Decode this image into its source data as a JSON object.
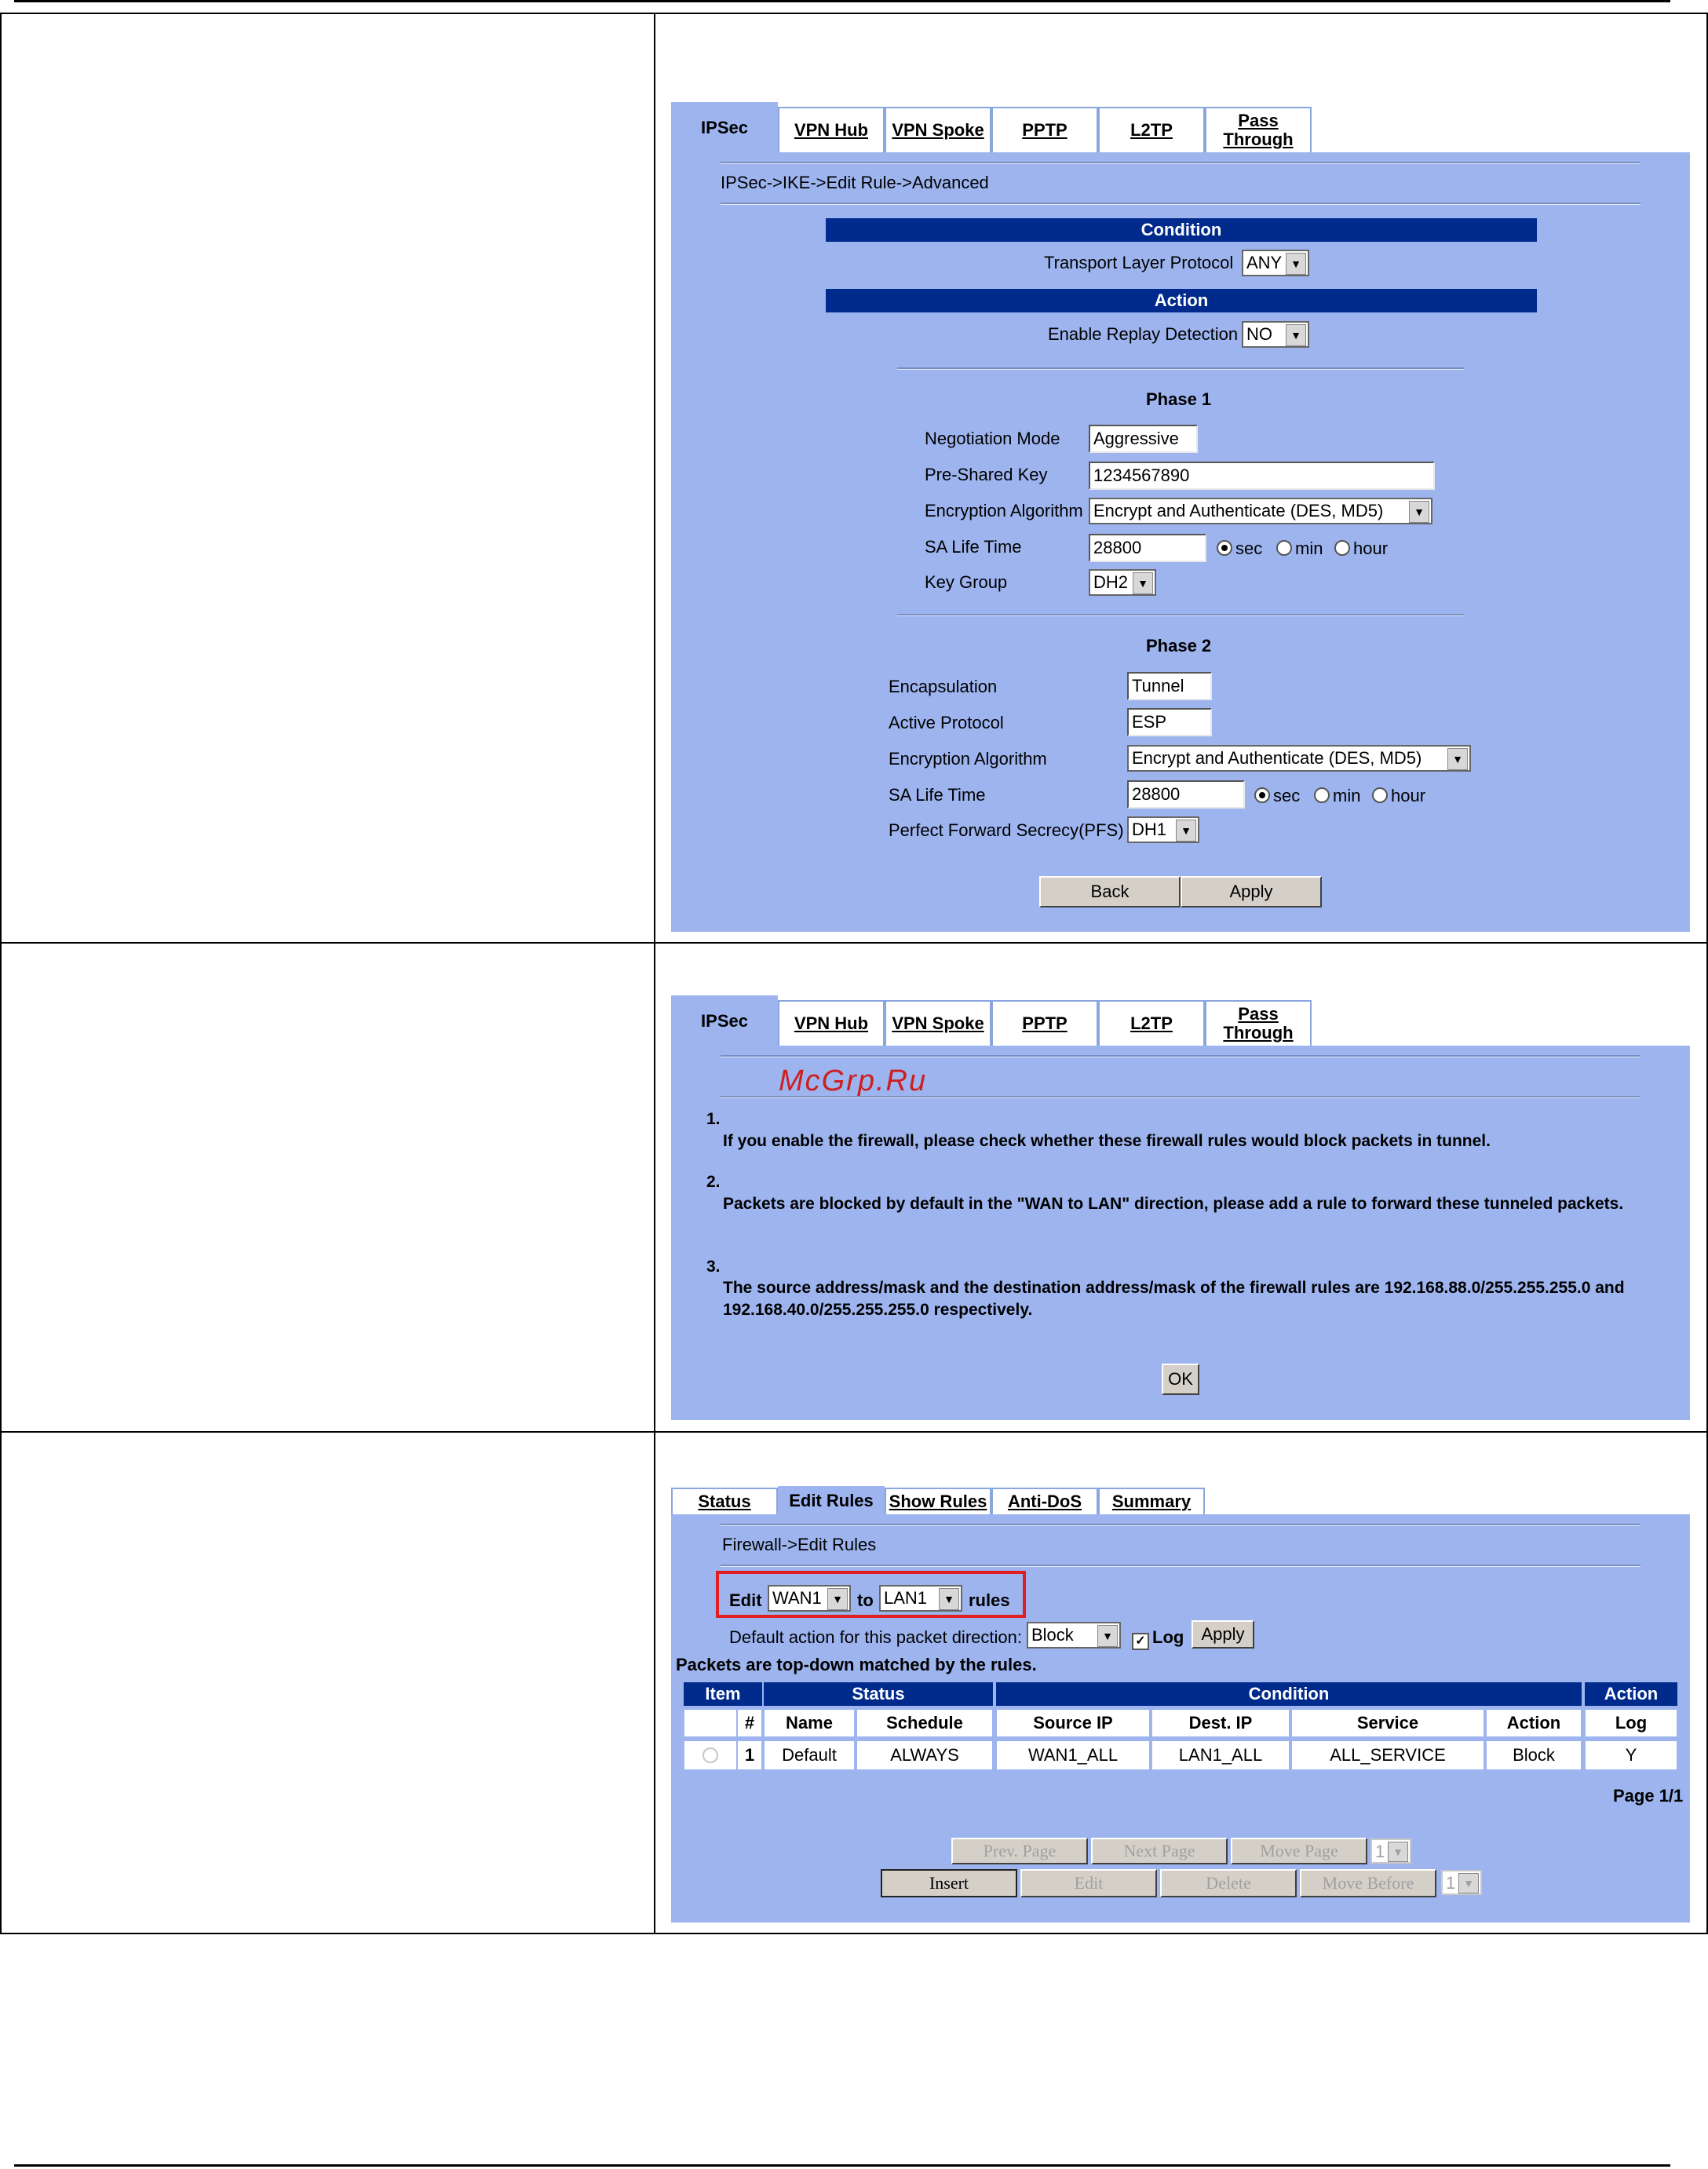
{
  "screen1": {
    "tabs": [
      {
        "label": "IPSec"
      },
      {
        "label": "VPN Hub"
      },
      {
        "label": "VPN Spoke"
      },
      {
        "label": "PPTP"
      },
      {
        "label": "L2TP"
      },
      {
        "label": "Pass Through"
      }
    ],
    "breadcrumb": "IPSec->IKE->Edit Rule->Advanced",
    "condition_header": "Condition",
    "transport_label": "Transport Layer Protocol",
    "transport_value": "ANY",
    "action_header": "Action",
    "replay_label": "Enable Replay Detection",
    "replay_value": "NO",
    "phase1": {
      "title": "Phase 1",
      "negotiation_label": "Negotiation Mode",
      "negotiation_value": "Aggressive",
      "psk_label": "Pre-Shared Key",
      "psk_value": "1234567890",
      "enc_label": "Encryption Algorithm",
      "enc_value": "Encrypt and Authenticate (DES, MD5)",
      "sa_label": "SA Life Time",
      "sa_value": "28800",
      "unit_sec": "sec",
      "unit_min": "min",
      "unit_hour": "hour",
      "keygroup_label": "Key Group",
      "keygroup_value": "DH2"
    },
    "phase2": {
      "title": "Phase 2",
      "encap_label": "Encapsulation",
      "encap_value": "Tunnel",
      "proto_label": "Active Protocol",
      "proto_value": "ESP",
      "enc_label": "Encryption Algorithm",
      "enc_value": "Encrypt and Authenticate (DES, MD5)",
      "sa_label": "SA Life Time",
      "sa_value": "28800",
      "unit_sec": "sec",
      "unit_min": "min",
      "unit_hour": "hour",
      "pfs_label": "Perfect Forward Secrecy(PFS)",
      "pfs_value": "DH1"
    },
    "back_label": "Back",
    "apply_label": "Apply"
  },
  "screen2": {
    "tabs": [
      {
        "label": "IPSec"
      },
      {
        "label": "VPN Hub"
      },
      {
        "label": "VPN Spoke"
      },
      {
        "label": "PPTP"
      },
      {
        "label": "L2TP"
      },
      {
        "label": "Pass Through"
      }
    ],
    "watermark": "McGrp.Ru",
    "notes": [
      {
        "num": "1.",
        "text": "If you enable the firewall, please check whether these firewall rules would block packets in tunnel."
      },
      {
        "num": "2.",
        "text": "Packets are blocked by default in the \"WAN to LAN\" direction, please add a rule to forward these tunneled packets."
      },
      {
        "num": "3.",
        "text": "The source address/mask and the destination address/mask of the firewall rules are 192.168.88.0/255.255.255.0 and 192.168.40.0/255.255.255.0 respectively."
      }
    ],
    "ok_label": "OK"
  },
  "screen3": {
    "tabs": [
      {
        "label": "Status"
      },
      {
        "label": "Edit Rules"
      },
      {
        "label": "Show Rules"
      },
      {
        "label": "Anti-DoS"
      },
      {
        "label": "Summary"
      }
    ],
    "breadcrumb": "Firewall->Edit Rules",
    "edit_label": "Edit",
    "from_value": "WAN1",
    "to_label": "to",
    "to_value": "LAN1",
    "rules_label": "rules",
    "default_label": "Default action for this packet direction:",
    "default_value": "Block",
    "log_label": "Log",
    "apply_label": "Apply",
    "matched_text": "Packets are top-down matched by the rules.",
    "group_headers": {
      "item": "Item",
      "status": "Status",
      "condition": "Condition",
      "action": "Action"
    },
    "columns": [
      "#",
      "Name",
      "Schedule",
      "Source IP",
      "Dest. IP",
      "Service",
      "Action",
      "Log"
    ],
    "rows": [
      {
        "num": "1",
        "name": "Default",
        "schedule": "ALWAYS",
        "source": "WAN1_ALL",
        "dest": "LAN1_ALL",
        "service": "ALL_SERVICE",
        "action": "Block",
        "log": "Y"
      }
    ],
    "page_info": "Page 1/1",
    "prev_page": "Prev. Page",
    "next_page": "Next Page",
    "move_page": "Move Page",
    "page_select": "1",
    "insert": "Insert",
    "edit": "Edit",
    "delete": "Delete",
    "move_before": "Move Before",
    "move_select": "1"
  },
  "colors": {
    "panel": "#9db4ef",
    "header_bar": "#002a8c",
    "highlight_box": "#e02020"
  }
}
